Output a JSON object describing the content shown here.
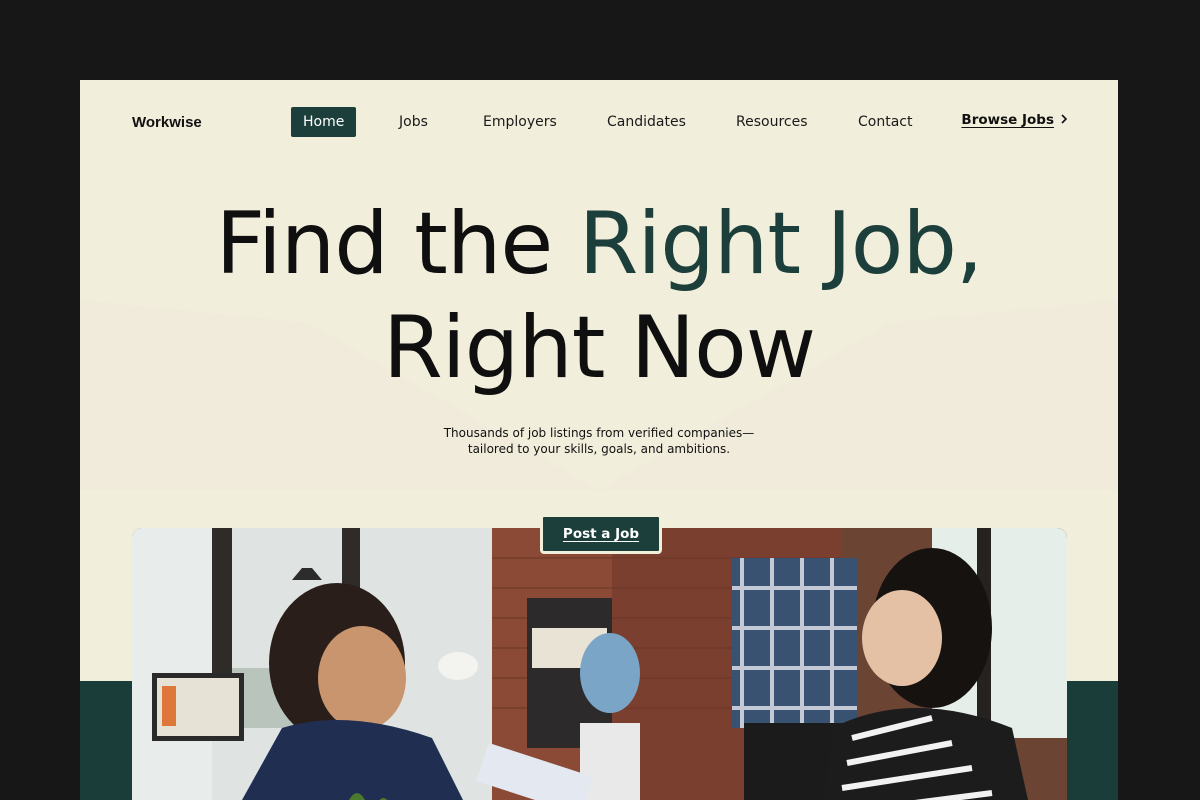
{
  "nav": {
    "logo": "Workwise",
    "items": [
      {
        "label": "Home",
        "active": true
      },
      {
        "label": "Jobs",
        "active": false
      },
      {
        "label": "Employers",
        "active": false
      },
      {
        "label": "Candidates",
        "active": false
      },
      {
        "label": "Resources",
        "active": false
      },
      {
        "label": "Contact",
        "active": false
      }
    ],
    "browse_label": "Browse Jobs",
    "browse_icon": "chevron-right-icon"
  },
  "hero": {
    "line1_plain": "Find the ",
    "line1_accent": "Right Job,",
    "line2": "Right Now",
    "subtext": "Thousands of job listings from verified companies—tailored to your skills, goals, and ambitions.",
    "cta_label": "Post a Job"
  },
  "colors": {
    "background": "#f2eedc",
    "accent": "#1c3f3b",
    "page_outer": "#171717"
  }
}
